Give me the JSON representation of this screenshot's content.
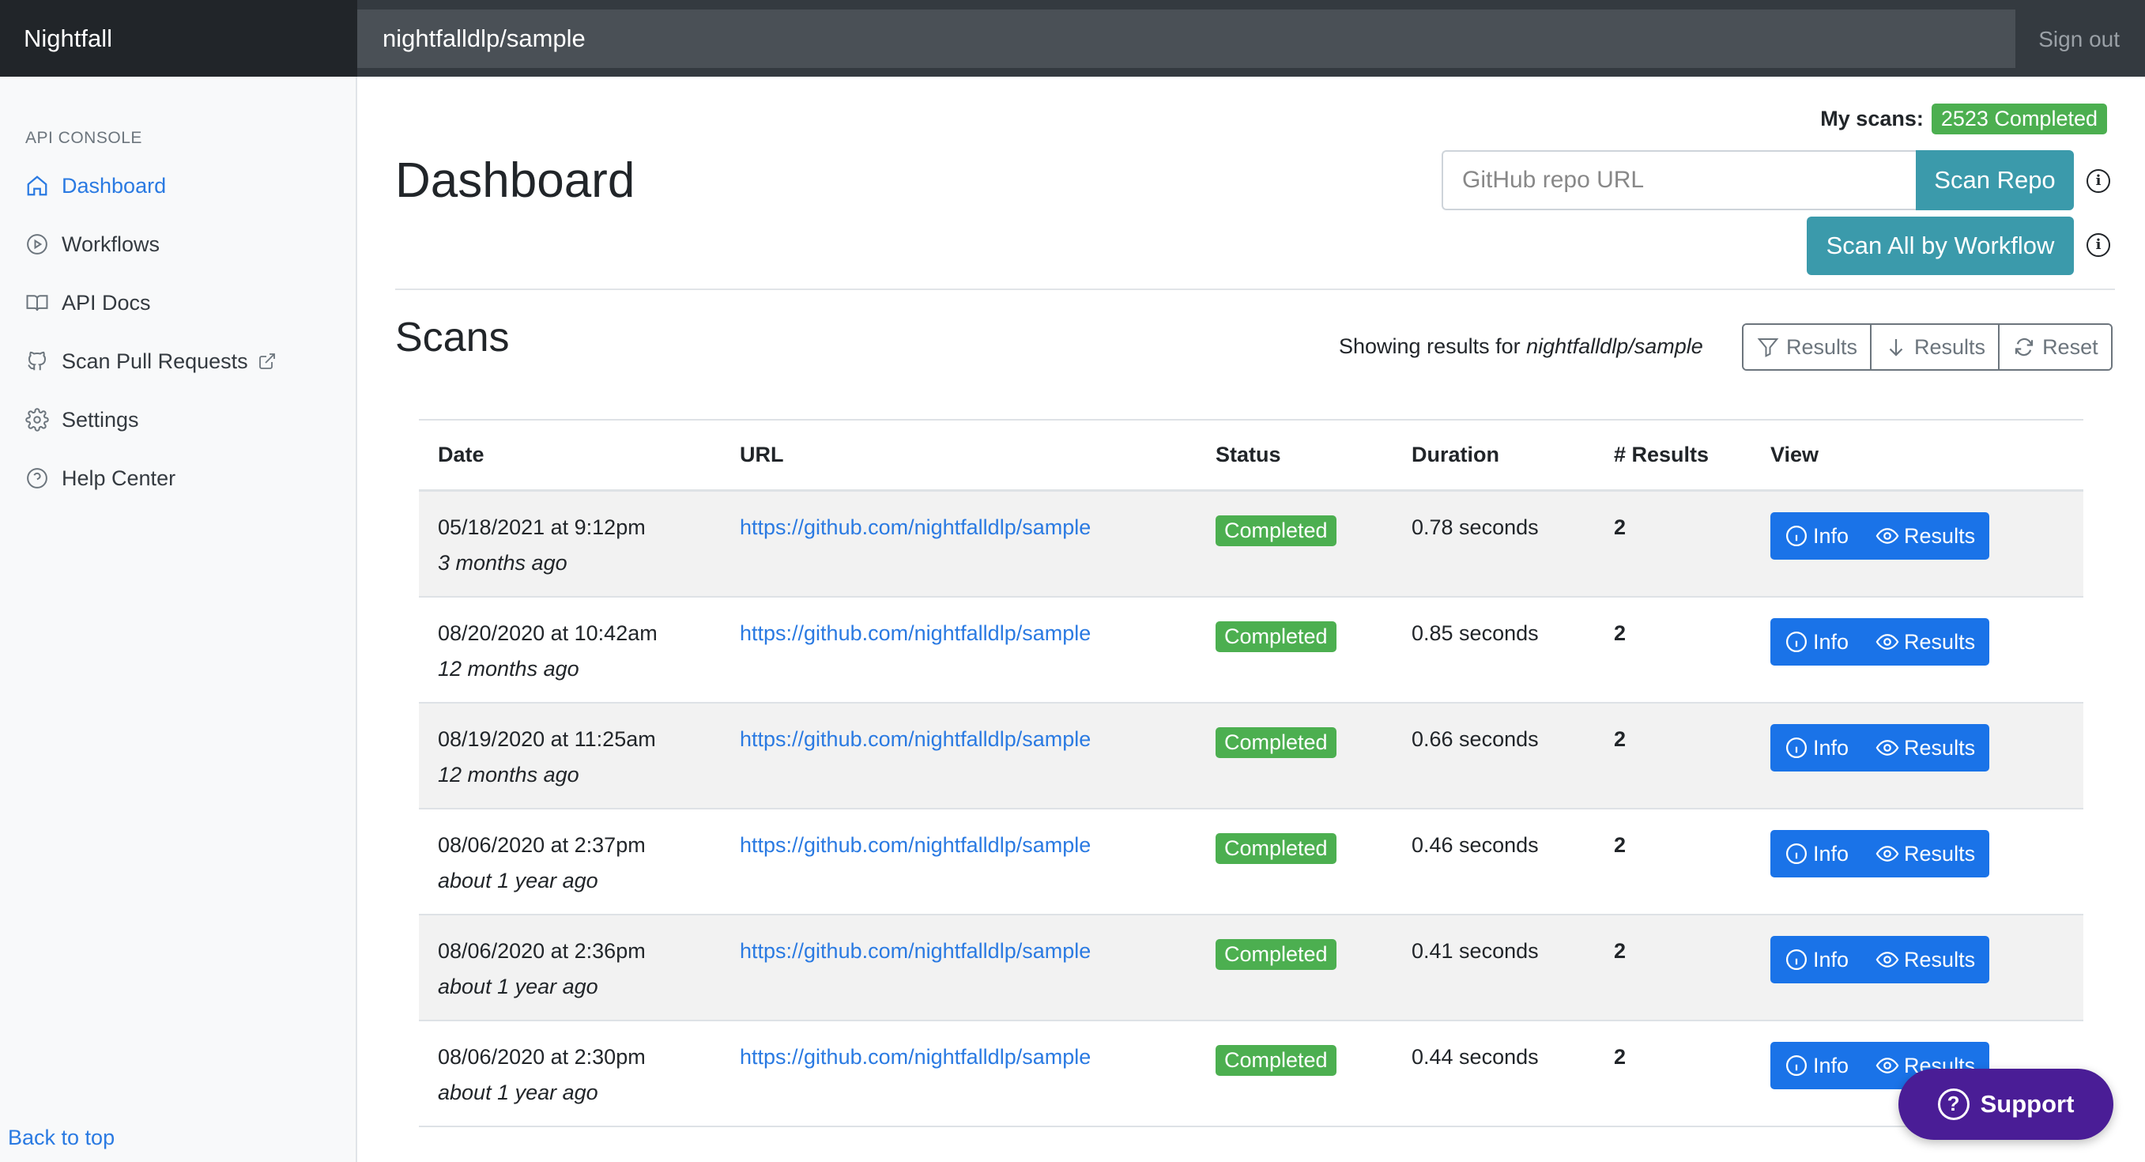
{
  "app": {
    "brand": "Nightfall",
    "repo": "nightfalldlp/sample",
    "signout": "Sign out"
  },
  "sidebar": {
    "heading": "API CONSOLE",
    "items": [
      {
        "label": "Dashboard",
        "icon": "home-icon",
        "active": true
      },
      {
        "label": "Workflows",
        "icon": "play-circle-icon"
      },
      {
        "label": "API Docs",
        "icon": "book-icon"
      },
      {
        "label": "Scan Pull Requests",
        "icon": "github-icon"
      },
      {
        "label": "Settings",
        "icon": "gear-icon"
      },
      {
        "label": "Help Center",
        "icon": "question-circle-icon"
      }
    ],
    "back_to_top": "Back to top"
  },
  "header": {
    "my_scans_label": "My scans:",
    "my_scans_badge": "2523 Completed",
    "title": "Dashboard",
    "search_placeholder": "GitHub repo URL",
    "scan_repo": "Scan Repo",
    "scan_all": "Scan All by Workflow",
    "info_glyph": "i"
  },
  "scans": {
    "title": "Scans",
    "showing_prefix": "Showing results for ",
    "showing_repo": "nightfalldlp/sample",
    "filter_btn": "Results",
    "download_btn": "Results",
    "reset_btn": "Reset",
    "columns": {
      "date": "Date",
      "url": "URL",
      "status": "Status",
      "duration": "Duration",
      "results": "# Results",
      "view": "View"
    },
    "view_info": "Info",
    "view_results": "Results",
    "rows": [
      {
        "date": "05/18/2021 at 9:12pm",
        "relative": "3 months ago",
        "url": "https://github.com/nightfalldlp/sample",
        "status": "Completed",
        "duration": "0.78 seconds",
        "results": "2"
      },
      {
        "date": "08/20/2020 at 10:42am",
        "relative": "12 months ago",
        "url": "https://github.com/nightfalldlp/sample",
        "status": "Completed",
        "duration": "0.85 seconds",
        "results": "2"
      },
      {
        "date": "08/19/2020 at 11:25am",
        "relative": "12 months ago",
        "url": "https://github.com/nightfalldlp/sample",
        "status": "Completed",
        "duration": "0.66 seconds",
        "results": "2"
      },
      {
        "date": "08/06/2020 at 2:37pm",
        "relative": "about 1 year ago",
        "url": "https://github.com/nightfalldlp/sample",
        "status": "Completed",
        "duration": "0.46 seconds",
        "results": "2"
      },
      {
        "date": "08/06/2020 at 2:36pm",
        "relative": "about 1 year ago",
        "url": "https://github.com/nightfalldlp/sample",
        "status": "Completed",
        "duration": "0.41 seconds",
        "results": "2"
      },
      {
        "date": "08/06/2020 at 2:30pm",
        "relative": "about 1 year ago",
        "url": "https://github.com/nightfalldlp/sample",
        "status": "Completed",
        "duration": "0.44 seconds",
        "results": "2"
      }
    ]
  },
  "support": {
    "label": "Support",
    "glyph": "?"
  },
  "colors": {
    "accent": "#2a7ae2",
    "teal": "#3b9aab",
    "success": "#4caf50",
    "support": "#4a1d96",
    "topbar": "#343a40"
  }
}
